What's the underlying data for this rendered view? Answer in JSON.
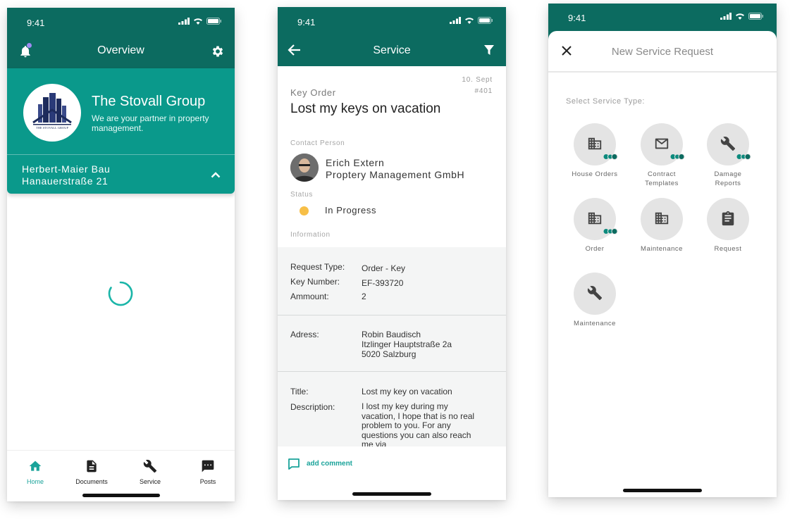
{
  "colors": {
    "primary_dark": "#0c6b60",
    "primary": "#0a998b",
    "accent": "#1aa39a",
    "status_in_progress": "#f7bf47",
    "notification_dot": "#a08bf2"
  },
  "statusbar": {
    "time": "9:41"
  },
  "overview": {
    "title": "Overview",
    "company": {
      "name": "The Stovall Group",
      "tagline": "We are your partner in property management.",
      "logo_text": "THE STOVALL GROUP"
    },
    "address": {
      "line1": "Herbert-Maier Bau",
      "line2": "Hanauerstraße 21"
    },
    "tabs": [
      {
        "label": "Home",
        "icon": "home-icon",
        "active": true
      },
      {
        "label": "Documents",
        "icon": "document-icon",
        "active": false
      },
      {
        "label": "Service",
        "icon": "wrench-icon",
        "active": false
      },
      {
        "label": "Posts",
        "icon": "chat-icon",
        "active": false
      }
    ]
  },
  "service": {
    "title": "Service",
    "date": "10. Sept",
    "number": "#401",
    "kind": "Key Order",
    "request_title": "Lost my keys on vacation",
    "contact_label": "Contact Person",
    "contact_name": "Erich Extern",
    "contact_company": "Proptery Management GmbH",
    "status_label": "Status",
    "status_value": "In Progress",
    "info_label": "Information",
    "info": {
      "request_type_label": "Request Type:",
      "request_type": "Order - Key",
      "key_number_label": "Key Number:",
      "key_number": "EF-393720",
      "amount_label": "Ammount:",
      "amount": "2",
      "address_label": "Adress:",
      "address_line1": "Robin Baudisch",
      "address_line2": "Itzlinger Hauptstraße 2a",
      "address_line3": "5020 Salzburg",
      "title_label": "Title:",
      "title_value": "Lost my key on vacation",
      "description_label": "Description:",
      "description_value": "I lost my key during my vacation, I hope that is no real problem to you. For any questions you can also reach me via"
    },
    "add_comment": "add comment"
  },
  "new_request": {
    "title": "New Service Request",
    "select_label": "Select Service Type:",
    "types": [
      {
        "label": "House Orders",
        "icon": "building-icon",
        "badge": true
      },
      {
        "label": "Contract Templates",
        "icon": "mail-icon",
        "badge": true
      },
      {
        "label": "Damage Reports",
        "icon": "wrench-icon",
        "badge": true
      },
      {
        "label": "Order",
        "icon": "building-icon",
        "badge": true
      },
      {
        "label": "Maintenance",
        "icon": "building-icon",
        "badge": false
      },
      {
        "label": "Request",
        "icon": "clipboard-icon",
        "badge": false
      },
      {
        "label": "Maintenance",
        "icon": "wrench-icon",
        "badge": false
      }
    ]
  }
}
